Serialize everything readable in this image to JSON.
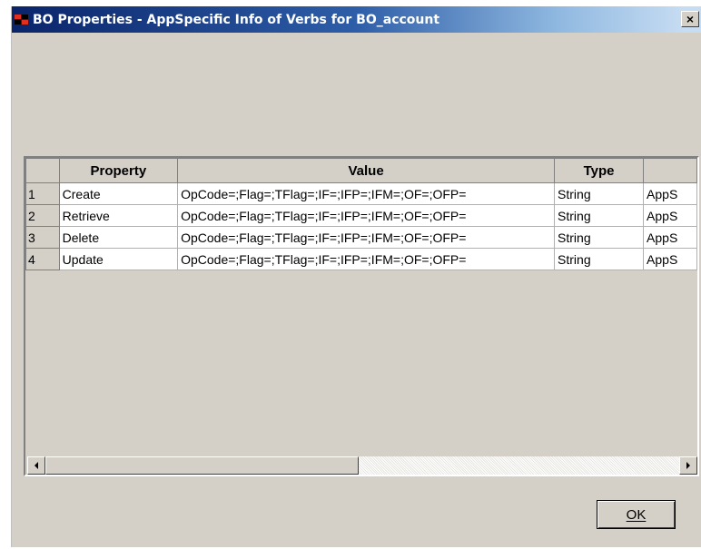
{
  "window": {
    "title": "BO Properties - AppSpecific Info of Verbs for  BO_account",
    "close_label": "×"
  },
  "grid": {
    "columns": [
      "",
      "Property",
      "Value",
      "Type",
      ""
    ],
    "rows": [
      {
        "num": "1",
        "property": "Create",
        "value": "OpCode=;Flag=;TFlag=;IF=;IFP=;IFM=;OF=;OFP=",
        "type": "String",
        "extra": "AppS"
      },
      {
        "num": "2",
        "property": "Retrieve",
        "value": "OpCode=;Flag=;TFlag=;IF=;IFP=;IFM=;OF=;OFP=",
        "type": "String",
        "extra": "AppS"
      },
      {
        "num": "3",
        "property": "Delete",
        "value": "OpCode=;Flag=;TFlag=;IF=;IFP=;IFM=;OF=;OFP=",
        "type": "String",
        "extra": "AppS"
      },
      {
        "num": "4",
        "property": "Update",
        "value": "OpCode=;Flag=;TFlag=;IF=;IFP=;IFM=;OF=;OFP=",
        "type": "String",
        "extra": "AppS"
      }
    ]
  },
  "buttons": {
    "ok_label": "OK"
  }
}
